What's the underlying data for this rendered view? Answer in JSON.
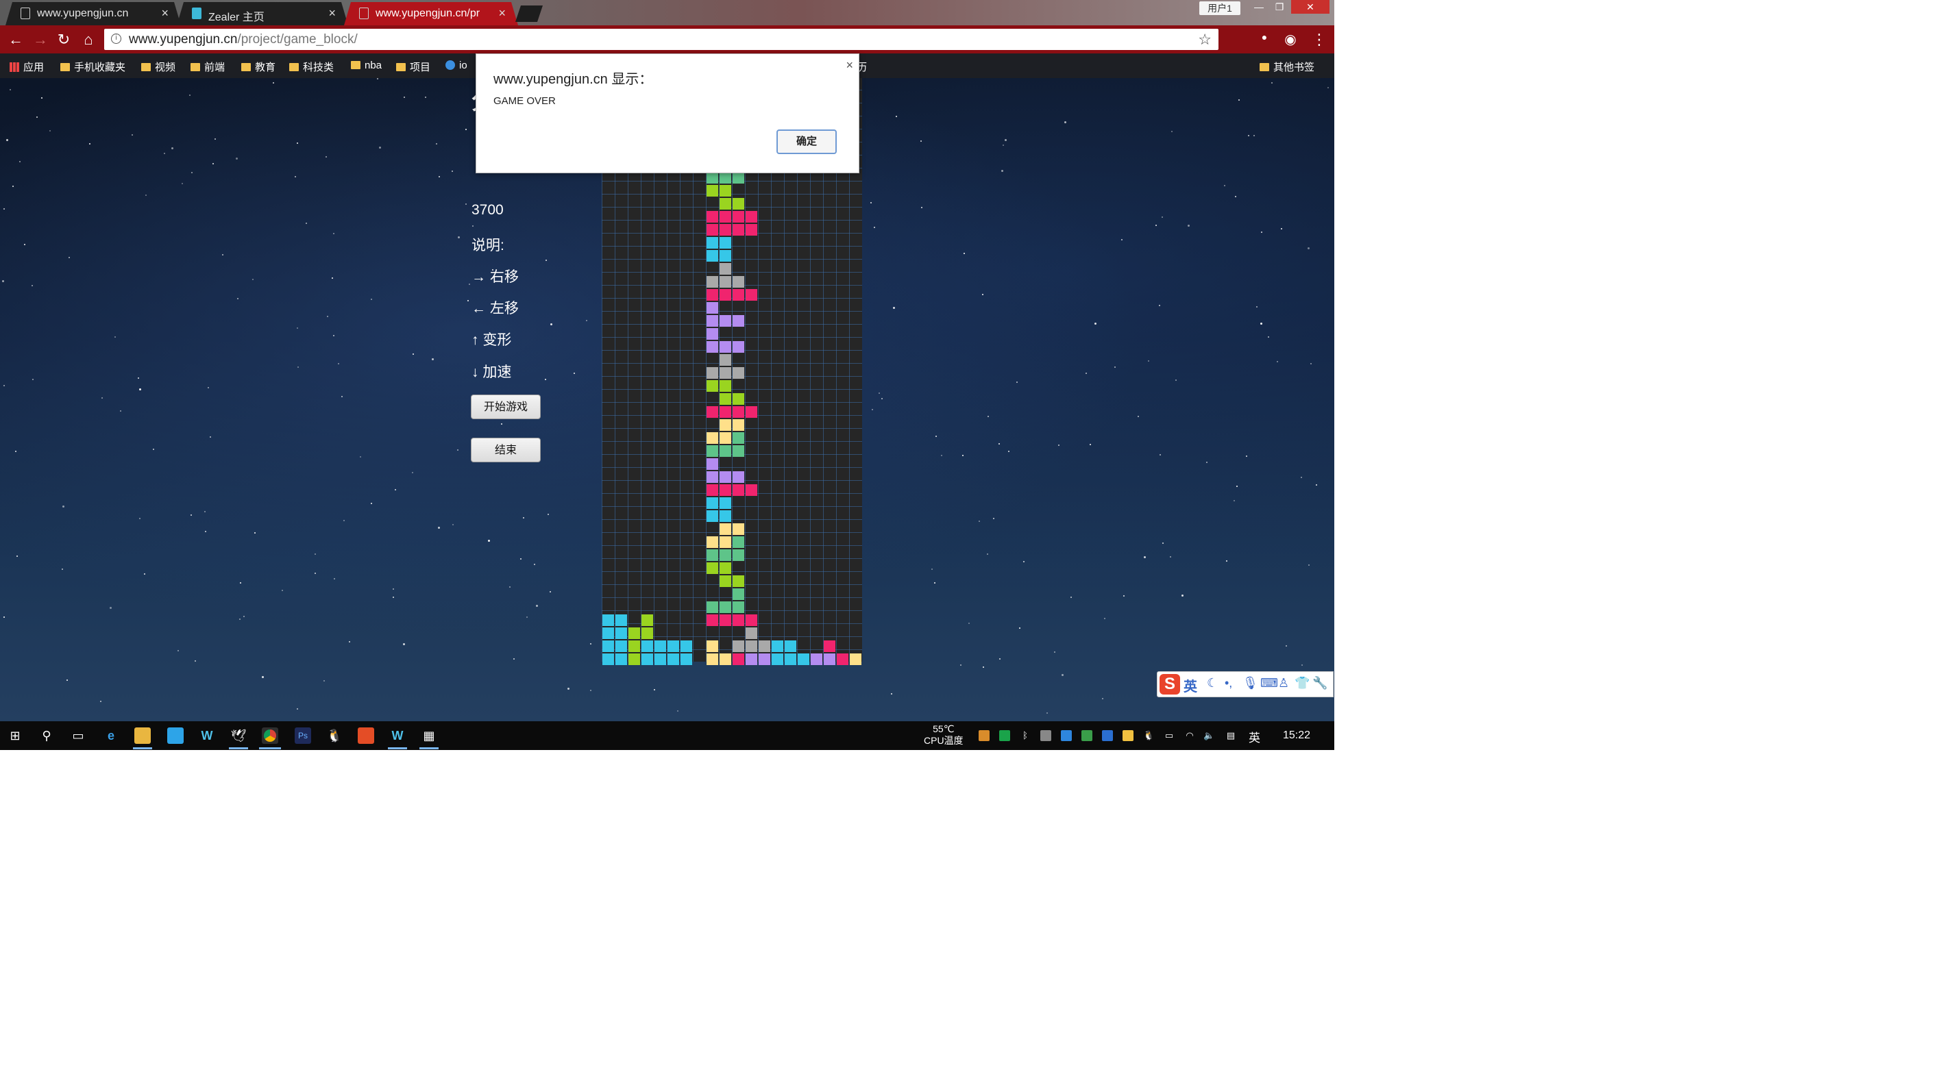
{
  "browser": {
    "tabs": [
      {
        "title": "www.yupengjun.cn",
        "active": false
      },
      {
        "title": "Zealer 主页",
        "active": false
      },
      {
        "title": "www.yupengjun.cn/pr",
        "active": true
      }
    ],
    "window_user": "用户1",
    "url_host": "www.yupengjun.cn",
    "url_path": "/project/game_block/",
    "bookmarks": [
      "应用",
      "手机收藏夹",
      "视频",
      "前端",
      "教育",
      "科技类",
      "nba",
      "项目",
      "io",
      "历",
      "其他书签"
    ]
  },
  "dialog": {
    "title": "www.yupengjun.cn 显示：",
    "message": "GAME OVER",
    "ok_label": "确定"
  },
  "game": {
    "score_title": "分数",
    "score": "3700",
    "instructions_title": "说明:",
    "instructions": [
      "→ 右移",
      "← 左移",
      "↑ 变形",
      "↓ 加速"
    ],
    "start_label": "开始游戏",
    "end_label": "结束",
    "colors": {
      "pink": "#f0246e",
      "cyan": "#36c7e8",
      "lime": "#9ad420",
      "green": "#5ec489",
      "purple": "#b48cf0",
      "gray": "#a9a9a9",
      "yellow": "#ffe08a"
    },
    "board": {
      "columns": 20,
      "rows": 45,
      "cells": [
        [
          8,
          0,
          "green"
        ],
        [
          9,
          0,
          "green"
        ],
        [
          10,
          0,
          "green"
        ],
        [
          8,
          1,
          "lime"
        ],
        [
          9,
          1,
          "lime"
        ],
        [
          9,
          2,
          "lime"
        ],
        [
          10,
          2,
          "lime"
        ],
        [
          8,
          3,
          "pink"
        ],
        [
          9,
          3,
          "pink"
        ],
        [
          10,
          3,
          "pink"
        ],
        [
          11,
          3,
          "pink"
        ],
        [
          8,
          4,
          "pink"
        ],
        [
          9,
          4,
          "pink"
        ],
        [
          10,
          4,
          "pink"
        ],
        [
          11,
          4,
          "pink"
        ],
        [
          8,
          5,
          "cyan"
        ],
        [
          9,
          5,
          "cyan"
        ],
        [
          8,
          6,
          "cyan"
        ],
        [
          9,
          6,
          "cyan"
        ],
        [
          9,
          7,
          "gray"
        ],
        [
          8,
          8,
          "gray"
        ],
        [
          9,
          8,
          "gray"
        ],
        [
          10,
          8,
          "gray"
        ],
        [
          8,
          9,
          "pink"
        ],
        [
          9,
          9,
          "pink"
        ],
        [
          10,
          9,
          "pink"
        ],
        [
          11,
          9,
          "pink"
        ],
        [
          8,
          10,
          "purple"
        ],
        [
          8,
          11,
          "purple"
        ],
        [
          9,
          11,
          "purple"
        ],
        [
          10,
          11,
          "purple"
        ],
        [
          8,
          12,
          "purple"
        ],
        [
          8,
          13,
          "purple"
        ],
        [
          9,
          13,
          "purple"
        ],
        [
          10,
          13,
          "purple"
        ],
        [
          9,
          14,
          "gray"
        ],
        [
          8,
          15,
          "gray"
        ],
        [
          9,
          15,
          "gray"
        ],
        [
          10,
          15,
          "gray"
        ],
        [
          8,
          16,
          "lime"
        ],
        [
          9,
          16,
          "lime"
        ],
        [
          9,
          17,
          "lime"
        ],
        [
          10,
          17,
          "lime"
        ],
        [
          8,
          18,
          "pink"
        ],
        [
          9,
          18,
          "pink"
        ],
        [
          10,
          18,
          "pink"
        ],
        [
          11,
          18,
          "pink"
        ],
        [
          9,
          19,
          "yellow"
        ],
        [
          10,
          19,
          "yellow"
        ],
        [
          8,
          20,
          "yellow"
        ],
        [
          9,
          20,
          "yellow"
        ],
        [
          10,
          20,
          "green"
        ],
        [
          8,
          21,
          "green"
        ],
        [
          9,
          21,
          "green"
        ],
        [
          10,
          21,
          "green"
        ],
        [
          8,
          22,
          "purple"
        ],
        [
          8,
          23,
          "purple"
        ],
        [
          9,
          23,
          "purple"
        ],
        [
          10,
          23,
          "purple"
        ],
        [
          8,
          24,
          "pink"
        ],
        [
          9,
          24,
          "pink"
        ],
        [
          10,
          24,
          "pink"
        ],
        [
          11,
          24,
          "pink"
        ],
        [
          8,
          25,
          "cyan"
        ],
        [
          9,
          25,
          "cyan"
        ],
        [
          8,
          26,
          "cyan"
        ],
        [
          9,
          26,
          "cyan"
        ],
        [
          9,
          27,
          "yellow"
        ],
        [
          10,
          27,
          "yellow"
        ],
        [
          8,
          28,
          "yellow"
        ],
        [
          9,
          28,
          "yellow"
        ],
        [
          10,
          28,
          "green"
        ],
        [
          8,
          29,
          "green"
        ],
        [
          9,
          29,
          "green"
        ],
        [
          10,
          29,
          "green"
        ],
        [
          8,
          30,
          "lime"
        ],
        [
          9,
          30,
          "lime"
        ],
        [
          9,
          31,
          "lime"
        ],
        [
          10,
          31,
          "lime"
        ],
        [
          10,
          32,
          "green"
        ],
        [
          8,
          33,
          "green"
        ],
        [
          9,
          33,
          "green"
        ],
        [
          10,
          33,
          "green"
        ],
        [
          8,
          34,
          "pink"
        ],
        [
          9,
          34,
          "pink"
        ],
        [
          10,
          34,
          "pink"
        ],
        [
          11,
          34,
          "pink"
        ],
        [
          0,
          34,
          "cyan"
        ],
        [
          1,
          34,
          "cyan"
        ],
        [
          3,
          34,
          "lime"
        ],
        [
          0,
          35,
          "cyan"
        ],
        [
          1,
          35,
          "cyan"
        ],
        [
          2,
          35,
          "lime"
        ],
        [
          3,
          35,
          "lime"
        ],
        [
          11,
          35,
          "gray"
        ],
        [
          0,
          36,
          "cyan"
        ],
        [
          1,
          36,
          "cyan"
        ],
        [
          2,
          36,
          "lime"
        ],
        [
          3,
          36,
          "cyan"
        ],
        [
          4,
          36,
          "cyan"
        ],
        [
          5,
          36,
          "cyan"
        ],
        [
          6,
          36,
          "cyan"
        ],
        [
          8,
          36,
          "yellow"
        ],
        [
          10,
          36,
          "gray"
        ],
        [
          11,
          36,
          "gray"
        ],
        [
          12,
          36,
          "gray"
        ],
        [
          13,
          36,
          "cyan"
        ],
        [
          14,
          36,
          "cyan"
        ],
        [
          17,
          36,
          "pink"
        ],
        [
          0,
          37,
          "cyan"
        ],
        [
          1,
          37,
          "cyan"
        ],
        [
          2,
          37,
          "lime"
        ],
        [
          3,
          37,
          "cyan"
        ],
        [
          4,
          37,
          "cyan"
        ],
        [
          5,
          37,
          "cyan"
        ],
        [
          6,
          37,
          "cyan"
        ],
        [
          8,
          37,
          "yellow"
        ],
        [
          9,
          37,
          "yellow"
        ],
        [
          10,
          37,
          "pink"
        ],
        [
          11,
          37,
          "purple"
        ],
        [
          12,
          37,
          "purple"
        ],
        [
          13,
          37,
          "cyan"
        ],
        [
          14,
          37,
          "cyan"
        ],
        [
          15,
          37,
          "cyan"
        ],
        [
          16,
          37,
          "purple"
        ],
        [
          17,
          37,
          "purple"
        ],
        [
          18,
          37,
          "pink"
        ],
        [
          19,
          37,
          "yellow"
        ]
      ]
    }
  },
  "ime": {
    "lang": "英"
  },
  "taskbar": {
    "temperature": "55℃",
    "temp_label": "CPU温度",
    "lang": "英",
    "clock": "15:22"
  }
}
